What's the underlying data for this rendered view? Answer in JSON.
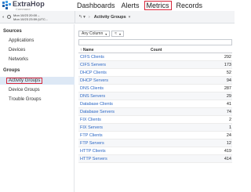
{
  "header": {
    "logo_name": "ExtraHop",
    "logo_sub": "Command",
    "nav": [
      "Dashboards",
      "Alerts",
      "Metrics",
      "Records"
    ]
  },
  "timebar": {
    "start": "Mon 10/23 20:00 –",
    "end": "Mon 10/23 23:59 (UTC..."
  },
  "breadcrumb": {
    "label": "Activity Groups"
  },
  "sidebar": {
    "sources_heading": "Sources",
    "sources": [
      "Applications",
      "Devices",
      "Networks"
    ],
    "groups_heading": "Groups",
    "groups": [
      "Activity Groups",
      "Device Groups",
      "Trouble Groups"
    ]
  },
  "filter": {
    "field": "Any Column",
    "operator": "≈"
  },
  "table": {
    "col_name": "↑ Name",
    "col_count": "Count",
    "rows": [
      {
        "name": "CIFS Clients",
        "count": "292"
      },
      {
        "name": "CIFS Servers",
        "count": "173"
      },
      {
        "name": "DHCP Clients",
        "count": "52"
      },
      {
        "name": "DHCP Servers",
        "count": "94"
      },
      {
        "name": "DNS Clients",
        "count": "287"
      },
      {
        "name": "DNS Servers",
        "count": "29"
      },
      {
        "name": "Database Clients",
        "count": "41"
      },
      {
        "name": "Database Servers",
        "count": "74"
      },
      {
        "name": "FIX Clients",
        "count": "2"
      },
      {
        "name": "FIX Servers",
        "count": "1"
      },
      {
        "name": "FTP Clients",
        "count": "24"
      },
      {
        "name": "FTP Servers",
        "count": "12"
      },
      {
        "name": "HTTP Clients",
        "count": "419"
      },
      {
        "name": "HTTP Servers",
        "count": "414"
      }
    ]
  }
}
